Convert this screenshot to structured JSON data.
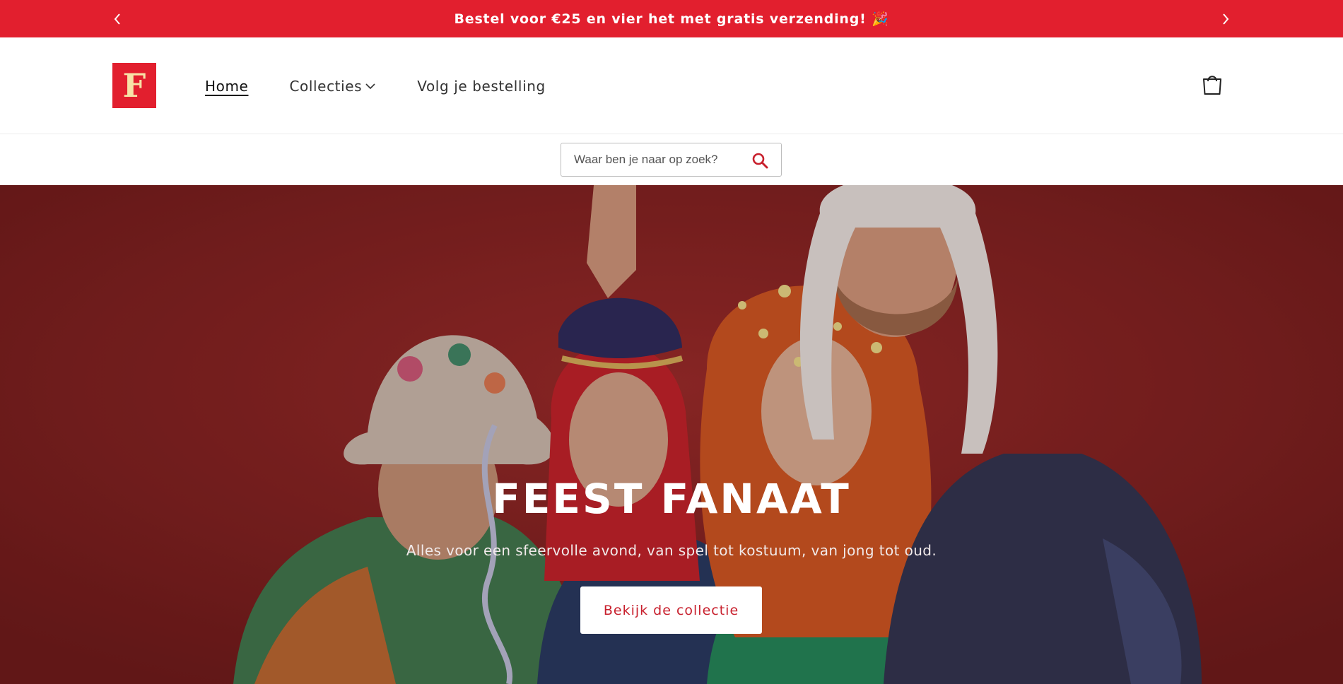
{
  "announcement": {
    "message": "Bestel voor €25 en vier het met gratis verzending! 🎉",
    "prev_icon": "chevron-left-icon",
    "next_icon": "chevron-right-icon"
  },
  "header": {
    "logo_letter": "F",
    "nav": [
      {
        "label": "Home",
        "active": true
      },
      {
        "label": "Collecties",
        "has_dropdown": true
      },
      {
        "label": "Volg je bestelling"
      }
    ],
    "cart_icon": "shopping-bag-icon"
  },
  "search": {
    "placeholder": "Waar ben je naar op zoek?",
    "icon": "search-icon"
  },
  "hero": {
    "title": "FEEST FANAAT",
    "subtitle": "Alles voor een sfeervolle avond, van spel tot kostuum, van jong tot oud.",
    "button_label": "Bekijk de collectie"
  },
  "colors": {
    "brand_red": "#e21f2e",
    "logo_letter": "#f7e2a7",
    "hero_bg": "#8b2423",
    "button_text": "#c8202d"
  }
}
